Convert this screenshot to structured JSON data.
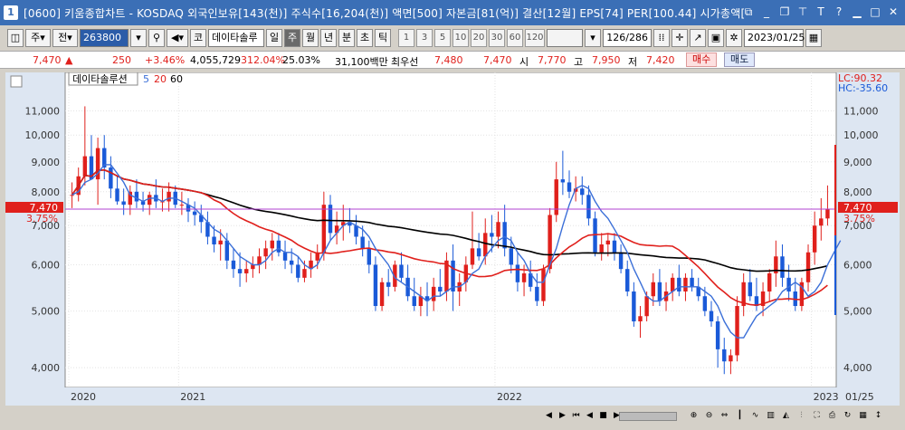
{
  "window": {
    "number": "1",
    "title": "[0600] 키움종합차트 - KOSDAQ 외국인보유[143(천)] 주식수[16,204(천)] 액면[500] 자본금[81(억)] 결산[12월] EPS[74] PER[100.44] 시가총액["
  },
  "toolbar": {
    "period_button": "주",
    "period_label": "전",
    "code": "263800",
    "coded_label": "코",
    "stock_name": "데이타솔루",
    "period_tabs": [
      "일",
      "주",
      "월",
      "년",
      "분",
      "초",
      "틱"
    ],
    "active_tab": "주",
    "numbers": [
      "1",
      "3",
      "5",
      "10",
      "20",
      "30",
      "60",
      "120"
    ],
    "count": "126/286",
    "date": "2023/01/25"
  },
  "quote": {
    "price": "7,470",
    "change": "250",
    "rate": "+3.46%",
    "volume": "4,055,729",
    "vol_ratio": "312.04%",
    "turnover": "25.03%",
    "amount": "31,100백만",
    "best_ask_label": "최우선",
    "best_ask": "7,480",
    "best_bid": "7,470",
    "open_label": "시",
    "open": "7,770",
    "high_label": "고",
    "high": "7,950",
    "low_label": "저",
    "low": "7,420",
    "buy_label": "매수",
    "sell_label": "매도"
  },
  "colors": {
    "up": "#e0201c",
    "down": "#1a5ad8",
    "ma5": "#3b6fd8",
    "ma20": "#e0201c",
    "ma60": "#000000",
    "price_line": "#b040d0"
  },
  "chart_data": {
    "type": "candlestick",
    "legend_name": "데이타솔루션",
    "legend_ma": [
      "5",
      "20",
      "60"
    ],
    "y_ticks": [
      4000,
      5000,
      6000,
      7000,
      8000,
      9000,
      10000,
      11000
    ],
    "y_tick_labels": [
      "4,000",
      "5,000",
      "6,000",
      "7,000",
      "8,000",
      "9,000",
      "10,000",
      "11,000"
    ],
    "x_labels": [
      {
        "label": "2020",
        "index": 0
      },
      {
        "label": "2021",
        "index": 17
      },
      {
        "label": "2022",
        "index": 66
      },
      {
        "label": "2023",
        "index": 115
      }
    ],
    "right_x_label": "01/25",
    "current_price": 7470,
    "current_price_label": "7,470",
    "current_rate_label": "3.75%",
    "lc_label": "LC:90.32",
    "hc_label": "HC:-35.60",
    "candles": [
      [
        7900,
        8300,
        7500,
        7900
      ],
      [
        7900,
        8800,
        7700,
        8500
      ],
      [
        8500,
        11200,
        8200,
        9200
      ],
      [
        9200,
        10000,
        8500,
        8400
      ],
      [
        8400,
        9900,
        7600,
        9500
      ],
      [
        9500,
        10000,
        8400,
        8800
      ],
      [
        8800,
        9200,
        7800,
        8100
      ],
      [
        8100,
        8500,
        7600,
        7700
      ],
      [
        7700,
        8100,
        7300,
        7600
      ],
      [
        7600,
        8200,
        7300,
        8000
      ],
      [
        8000,
        8400,
        7500,
        7700
      ],
      [
        7700,
        8000,
        7400,
        7600
      ],
      [
        7600,
        8000,
        7300,
        7900
      ],
      [
        7900,
        8400,
        7500,
        7700
      ],
      [
        7700,
        8100,
        7400,
        7700
      ],
      [
        7700,
        8300,
        7400,
        8000
      ],
      [
        8000,
        8200,
        7500,
        7600
      ],
      [
        7600,
        8000,
        7300,
        7600
      ],
      [
        7600,
        7800,
        7100,
        7400
      ],
      [
        7400,
        7700,
        7000,
        7300
      ],
      [
        7300,
        7600,
        6800,
        7100
      ],
      [
        7100,
        7400,
        6500,
        6700
      ],
      [
        6700,
        7000,
        6300,
        6500
      ],
      [
        6500,
        6900,
        6100,
        6600
      ],
      [
        6600,
        6800,
        5900,
        6100
      ],
      [
        6100,
        6400,
        5700,
        5900
      ],
      [
        5900,
        6300,
        5500,
        5800
      ],
      [
        5800,
        6100,
        5600,
        5900
      ],
      [
        5900,
        6200,
        5700,
        6000
      ],
      [
        6000,
        6400,
        5800,
        6200
      ],
      [
        6200,
        6600,
        5900,
        6400
      ],
      [
        6400,
        6800,
        6100,
        6600
      ],
      [
        6600,
        6800,
        6200,
        6300
      ],
      [
        6300,
        6600,
        5900,
        6100
      ],
      [
        6100,
        6400,
        5800,
        6000
      ],
      [
        6000,
        6200,
        5600,
        5700
      ],
      [
        5700,
        6100,
        5600,
        5900
      ],
      [
        5900,
        6300,
        5700,
        6100
      ],
      [
        6100,
        6500,
        5900,
        6300
      ],
      [
        6300,
        8000,
        6100,
        7600
      ],
      [
        7600,
        7900,
        6600,
        6800
      ],
      [
        6800,
        7400,
        6500,
        7000
      ],
      [
        7000,
        7600,
        6600,
        7100
      ],
      [
        7100,
        7500,
        6800,
        7000
      ],
      [
        7000,
        7300,
        6500,
        6700
      ],
      [
        6700,
        7000,
        6200,
        6400
      ],
      [
        6400,
        6600,
        5800,
        6000
      ],
      [
        6000,
        6200,
        5000,
        5100
      ],
      [
        5100,
        5700,
        5000,
        5600
      ],
      [
        5600,
        5900,
        5300,
        5500
      ],
      [
        5500,
        6100,
        5400,
        6000
      ],
      [
        6000,
        6300,
        5600,
        5700
      ],
      [
        5700,
        6000,
        5200,
        5300
      ],
      [
        5300,
        5700,
        5000,
        5100
      ],
      [
        5100,
        5500,
        4900,
        5300
      ],
      [
        5300,
        5600,
        4900,
        5200
      ],
      [
        5200,
        5700,
        5000,
        5500
      ],
      [
        5500,
        5900,
        5300,
        5400
      ],
      [
        5400,
        6300,
        5200,
        6100
      ],
      [
        6100,
        6500,
        5000,
        5400
      ],
      [
        5400,
        5800,
        5100,
        5600
      ],
      [
        5600,
        6200,
        5400,
        6000
      ],
      [
        6000,
        7400,
        5900,
        6400
      ],
      [
        6400,
        6800,
        6100,
        6200
      ],
      [
        6200,
        7200,
        6000,
        6800
      ],
      [
        6800,
        7300,
        6300,
        6700
      ],
      [
        6700,
        7400,
        6400,
        7100
      ],
      [
        7100,
        7600,
        6200,
        6400
      ],
      [
        6400,
        6700,
        5800,
        6000
      ],
      [
        6000,
        6300,
        5400,
        5600
      ],
      [
        5600,
        6000,
        5300,
        5800
      ],
      [
        5800,
        6100,
        5400,
        5500
      ],
      [
        5500,
        5800,
        5100,
        5200
      ],
      [
        5200,
        6000,
        5100,
        5900
      ],
      [
        5900,
        7500,
        5800,
        7300
      ],
      [
        7300,
        9000,
        7100,
        8400
      ],
      [
        8400,
        9400,
        7900,
        8300
      ],
      [
        8300,
        8700,
        7800,
        8000
      ],
      [
        8000,
        8500,
        7700,
        8100
      ],
      [
        8100,
        8500,
        7600,
        7900
      ],
      [
        7900,
        8200,
        7000,
        7200
      ],
      [
        7200,
        7400,
        6200,
        6300
      ],
      [
        6300,
        6800,
        6100,
        6500
      ],
      [
        6500,
        6800,
        6200,
        6600
      ],
      [
        6600,
        6800,
        6100,
        6300
      ],
      [
        6300,
        6500,
        5800,
        5900
      ],
      [
        5900,
        6100,
        5300,
        5400
      ],
      [
        5400,
        5600,
        4700,
        4800
      ],
      [
        4800,
        5100,
        4500,
        4900
      ],
      [
        4900,
        5400,
        4800,
        5300
      ],
      [
        5300,
        5800,
        5100,
        5600
      ],
      [
        5600,
        5900,
        5100,
        5200
      ],
      [
        5200,
        5600,
        5000,
        5400
      ],
      [
        5400,
        5800,
        5200,
        5700
      ],
      [
        5700,
        6000,
        5300,
        5400
      ],
      [
        5400,
        5800,
        5200,
        5700
      ],
      [
        5700,
        5900,
        5400,
        5500
      ],
      [
        5500,
        5700,
        5200,
        5300
      ],
      [
        5300,
        5500,
        4900,
        5000
      ],
      [
        5000,
        5200,
        4700,
        4800
      ],
      [
        4800,
        4900,
        4000,
        4300
      ],
      [
        4300,
        4500,
        3900,
        4100
      ],
      [
        4100,
        4300,
        3900,
        4200
      ],
      [
        4200,
        5300,
        4100,
        5100
      ],
      [
        5100,
        5800,
        4900,
        5600
      ],
      [
        5600,
        5900,
        5200,
        5300
      ],
      [
        5300,
        5700,
        5000,
        5100
      ],
      [
        5100,
        5600,
        4900,
        5400
      ],
      [
        5400,
        5900,
        5200,
        5800
      ],
      [
        5800,
        6600,
        5500,
        6200
      ],
      [
        6200,
        6500,
        5500,
        5700
      ],
      [
        5700,
        6000,
        5200,
        5400
      ],
      [
        5400,
        5700,
        5000,
        5100
      ],
      [
        5100,
        5700,
        5000,
        5600
      ],
      [
        5600,
        6500,
        5400,
        6300
      ],
      [
        6300,
        7400,
        6000,
        7000
      ],
      [
        7000,
        7800,
        6600,
        7200
      ],
      [
        7200,
        8200,
        7000,
        7470
      ]
    ],
    "ma5": [
      7900,
      8000,
      8300,
      8400,
      8600,
      8900,
      8900,
      8600,
      8300,
      7900,
      7800,
      7700,
      7800,
      7800,
      7700,
      7800,
      7800,
      7700,
      7600,
      7500,
      7300,
      7100,
      6900,
      6800,
      6600,
      6400,
      6200,
      6100,
      6000,
      6000,
      6100,
      6300,
      6400,
      6300,
      6300,
      6200,
      6000,
      5900,
      6000,
      6300,
      6600,
      6800,
      7000,
      7100,
      7000,
      6900,
      6700,
      6400,
      6200,
      6000,
      5700,
      5600,
      5500,
      5400,
      5300,
      5200,
      5300,
      5300,
      5400,
      5500,
      5500,
      5600,
      5800,
      5900,
      6200,
      6400,
      6600,
      6700,
      6600,
      6300,
      6100,
      5800,
      5600,
      5600,
      6000,
      6400,
      7000,
      7600,
      8100,
      8200,
      8100,
      7700,
      7400,
      7200,
      6900,
      6600,
      6300,
      5900,
      5600,
      5300,
      5200,
      5200,
      5300,
      5400,
      5500,
      5500,
      5500,
      5500,
      5400,
      5300,
      5100,
      4800,
      4600,
      4500,
      4500,
      4700,
      4900,
      5000,
      5100,
      5200,
      5400,
      5500,
      5600,
      5500,
      5300,
      5400,
      5600,
      6000,
      6300,
      6600
    ]
  },
  "bottom_scroll": [
    "◀",
    "▶",
    "⏮",
    "◀",
    "■",
    "▶"
  ]
}
